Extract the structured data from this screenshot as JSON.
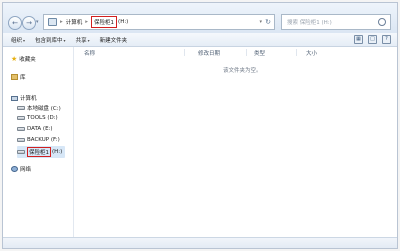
{
  "address": {
    "crumbs": [
      "计算机",
      "保险柜1"
    ],
    "current_tail": "(H:)",
    "search_placeholder": "搜索 保险柜1 (H:)"
  },
  "toolbar": {
    "items": [
      "组织",
      "包含到库中",
      "共享",
      "新建文件夹"
    ]
  },
  "sidebar": {
    "favorites": "收藏夹",
    "libraries": "库",
    "computer": "计算机",
    "drives": [
      "本地磁盘 (C:)",
      "TOOLS (D:)",
      "DATA (E:)",
      "BACKUP (F:)"
    ],
    "selected_drive_label": "保险柜1",
    "selected_drive_tail": "(H:)",
    "network": "网络"
  },
  "columns": [
    "名称",
    "修改日期",
    "类型",
    "大小"
  ],
  "empty_message": "该文件夹为空。",
  "colors": {
    "highlight": "#d21f1f",
    "selection": "#d7e7f7"
  }
}
